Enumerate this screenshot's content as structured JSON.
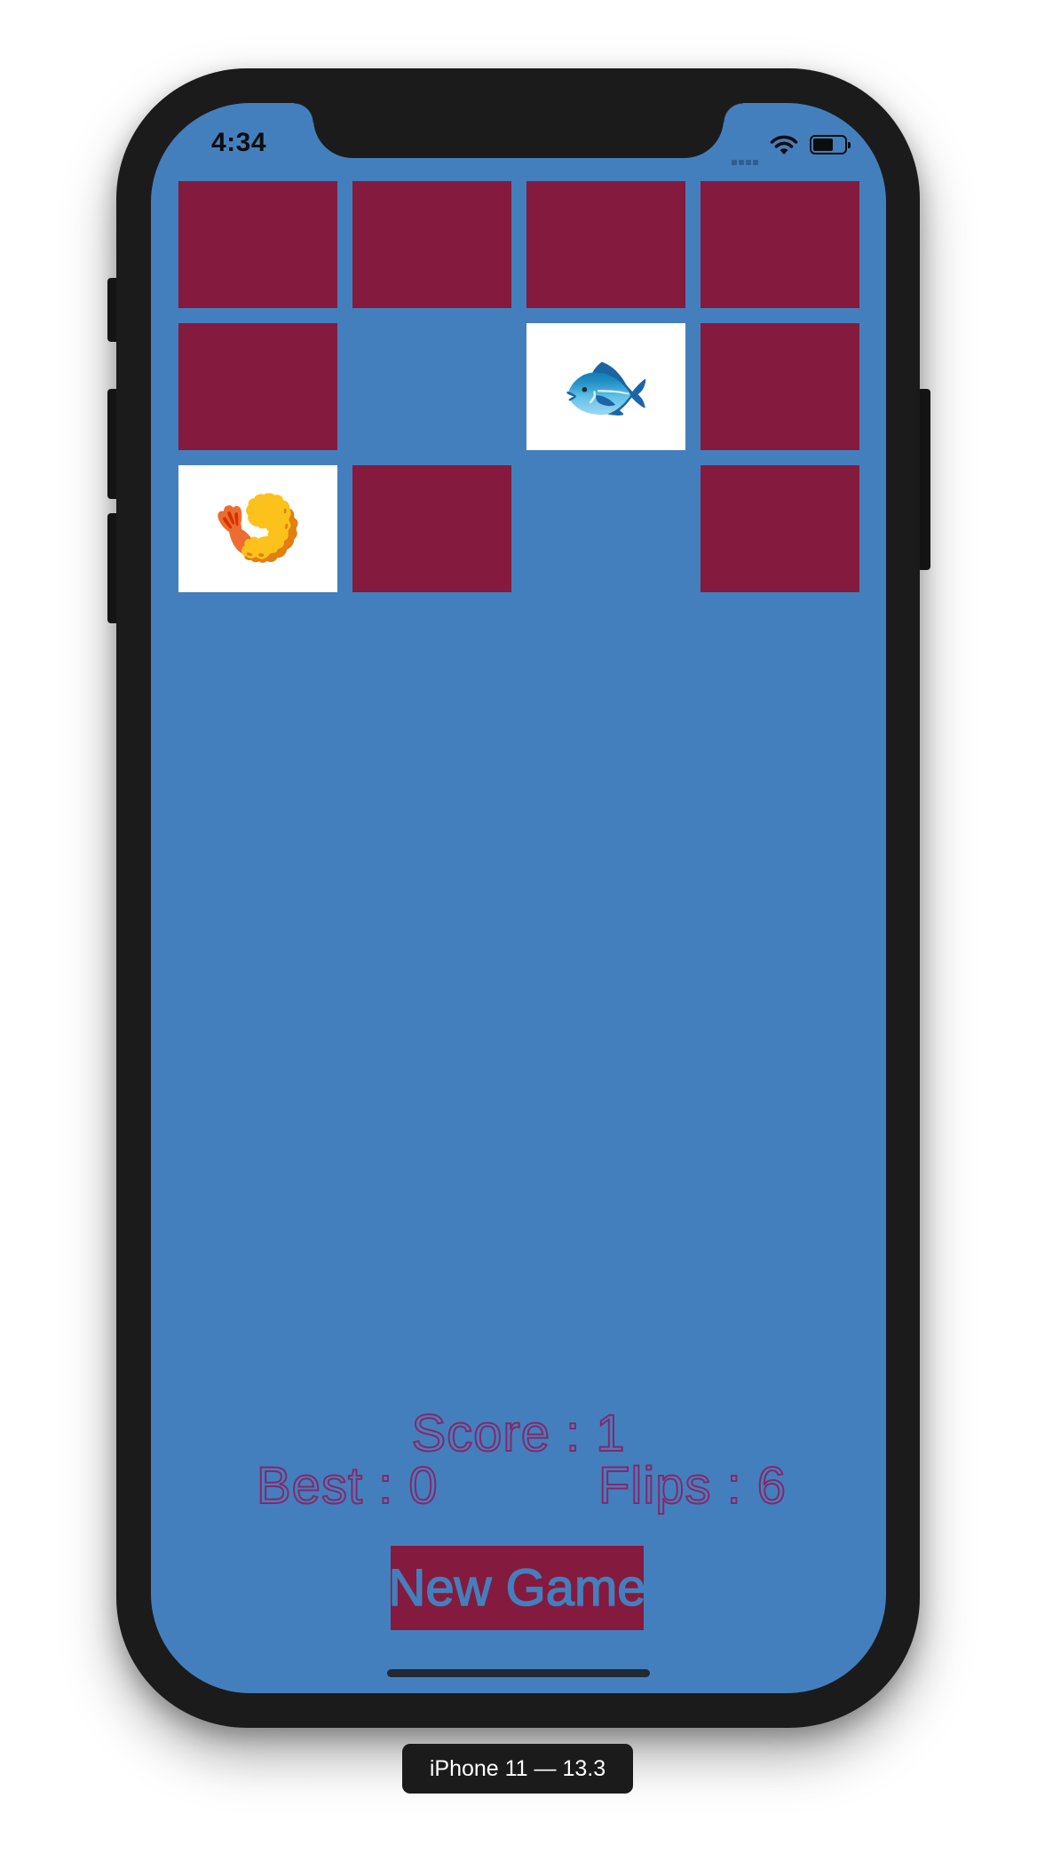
{
  "status_bar": {
    "time": "4:34",
    "icons": [
      "cellular-signal-icon",
      "wifi-icon",
      "battery-icon"
    ],
    "battery_level_fraction": 0.55
  },
  "game": {
    "cards": [
      {
        "state": "face-down",
        "emoji": ""
      },
      {
        "state": "face-down",
        "emoji": ""
      },
      {
        "state": "face-down",
        "emoji": ""
      },
      {
        "state": "face-down",
        "emoji": ""
      },
      {
        "state": "face-down",
        "emoji": ""
      },
      {
        "state": "matched",
        "emoji": ""
      },
      {
        "state": "face-up",
        "emoji": "🐟"
      },
      {
        "state": "face-down",
        "emoji": ""
      },
      {
        "state": "face-up",
        "emoji": "🍤"
      },
      {
        "state": "face-down",
        "emoji": ""
      },
      {
        "state": "matched",
        "emoji": ""
      },
      {
        "state": "face-down",
        "emoji": ""
      }
    ],
    "score_text": "Score : 1",
    "best_text": "Best : 0",
    "flips_text": "Flips : 6",
    "new_game_label": "New Game"
  },
  "colors": {
    "background": "#447fbd",
    "card_back": "#841a3d",
    "card_face": "#ffffff",
    "stat_text_outline": "#86276a"
  },
  "simulator": {
    "device_label": "iPhone 11 — 13.3"
  }
}
